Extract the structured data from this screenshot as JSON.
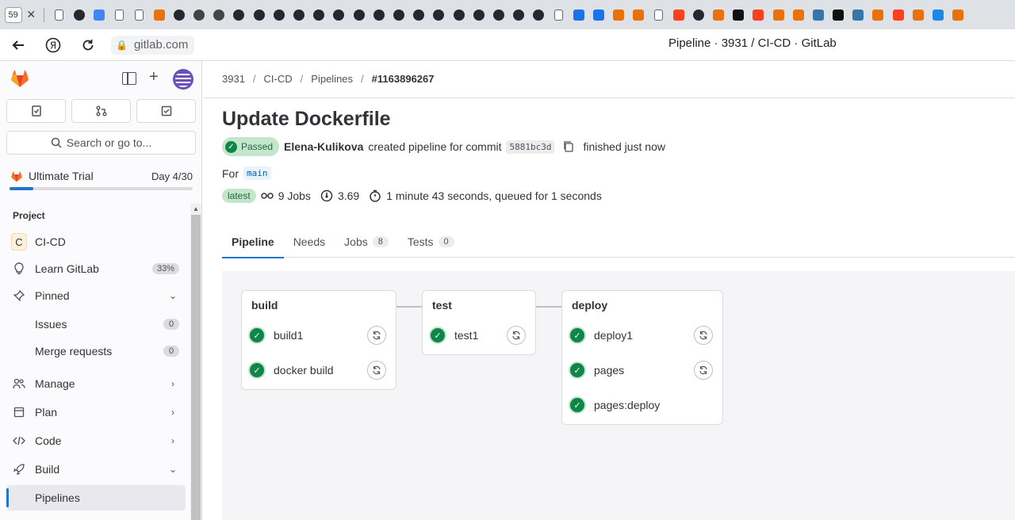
{
  "browser": {
    "tab_count": "59",
    "url": "gitlab.com",
    "page_title": "Pipeline · 3931 / CI-CD · GitLab",
    "tab_icons": [
      "page-icon",
      "github-icon",
      "docs-icon",
      "page-icon",
      "page-icon",
      "app-icon",
      "github-icon",
      "openai-icon",
      "openai-icon",
      "github-icon",
      "github-icon",
      "github-icon",
      "github-icon",
      "github-icon",
      "github-icon",
      "github-icon",
      "github-icon",
      "github-icon",
      "github-icon",
      "github-icon",
      "github-icon",
      "github-icon",
      "github-icon",
      "github-icon",
      "github-icon",
      "page-icon",
      "yc-icon",
      "yc-icon",
      "app-icon",
      "app-icon",
      "page-icon",
      "yandex-icon",
      "github-icon",
      "app-icon",
      "terminal-icon",
      "yandex-icon",
      "app-icon",
      "app-icon",
      "python-icon",
      "terminal-icon",
      "python-icon",
      "app-icon",
      "yandex-icon",
      "app-icon",
      "check-icon",
      "app-icon"
    ]
  },
  "sidebar": {
    "search_placeholder": "Search or go to...",
    "trial": {
      "name": "Ultimate Trial",
      "day": "Day 4/30",
      "progress": 0.13
    },
    "section": "Project",
    "project": {
      "initial": "C",
      "name": "CI-CD"
    },
    "learn": {
      "label": "Learn GitLab",
      "count": "33%"
    },
    "pinned": {
      "label": "Pinned",
      "items": [
        {
          "label": "Issues",
          "count": "0"
        },
        {
          "label": "Merge requests",
          "count": "0"
        }
      ]
    },
    "groups": [
      {
        "label": "Manage"
      },
      {
        "label": "Plan"
      },
      {
        "label": "Code"
      },
      {
        "label": "Build"
      }
    ],
    "active_sub": "Pipelines"
  },
  "breadcrumb": {
    "items": [
      "3931",
      "CI-CD",
      "Pipelines"
    ],
    "current": "#1163896267"
  },
  "pipeline": {
    "title": "Update Dockerfile",
    "status": "Passed",
    "author": "Elena-Kulikova",
    "created_text": "created pipeline for commit",
    "commit": "5881bc3d",
    "finished": "finished just now",
    "for_label": "For",
    "ref": "main",
    "latest": "latest",
    "jobs": "9 Jobs",
    "score": "3.69",
    "duration": "1 minute 43 seconds, queued for 1 seconds"
  },
  "tabs": [
    {
      "label": "Pipeline",
      "count": null
    },
    {
      "label": "Needs",
      "count": null
    },
    {
      "label": "Jobs",
      "count": "8"
    },
    {
      "label": "Tests",
      "count": "0"
    }
  ],
  "stages": [
    {
      "name": "build",
      "jobs": [
        {
          "name": "build1",
          "retry": true
        },
        {
          "name": "docker build",
          "retry": true
        }
      ]
    },
    {
      "name": "test",
      "jobs": [
        {
          "name": "test1",
          "retry": true
        }
      ]
    },
    {
      "name": "deploy",
      "jobs": [
        {
          "name": "deploy1",
          "retry": true
        },
        {
          "name": "pages",
          "retry": true
        },
        {
          "name": "pages:deploy",
          "retry": false
        }
      ]
    }
  ],
  "colors": {
    "success": "#108548",
    "accent": "#1f75cb",
    "gitlab_orange": "#fc6d26"
  }
}
